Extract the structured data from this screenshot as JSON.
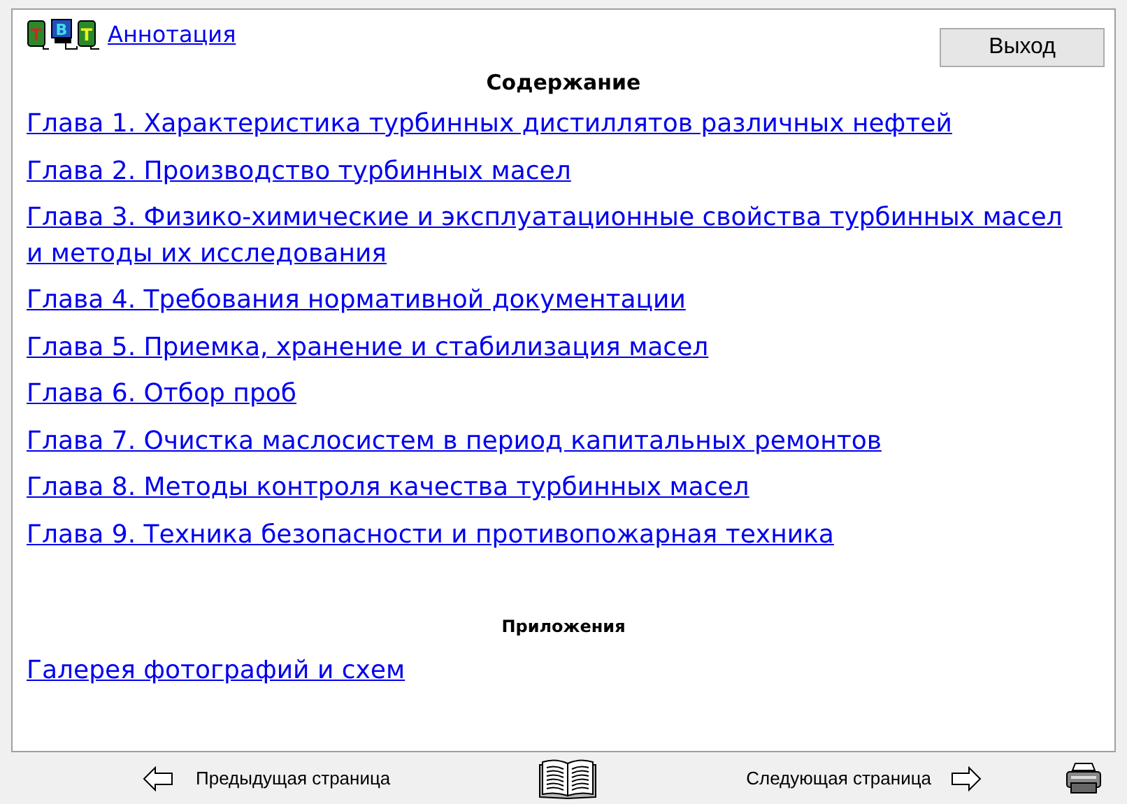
{
  "logo": {
    "letters": [
      "Т",
      "В",
      "Т"
    ]
  },
  "annotation_link": "Аннотация",
  "exit_button": "Выход",
  "contents": {
    "title": "Содержание",
    "chapters": [
      "Глава 1. Характеристика турбинных дистиллятов различных нефтей",
      "Глава 2. Производство турбинных масел",
      "Глава 3. Физико-химические и эксплуатационные свойства турбинных масел и методы их исследования",
      "Глава 4. Требования нормативной документации",
      "Глава 5. Приемка, хранение и стабилизация масел",
      "Глава 6. Отбор проб",
      "Глава 7. Очистка маслосистем в период капитальных ремонтов",
      "Глава 8. Методы контроля качества турбинных масел",
      "Глава 9. Техника безопасности и противопожарная техника"
    ]
  },
  "appendices": {
    "title": "Приложения",
    "links": [
      "Галерея фотографий и схем"
    ]
  },
  "footer": {
    "previous": "Предыдущая страница",
    "next": "Следующая страница"
  }
}
